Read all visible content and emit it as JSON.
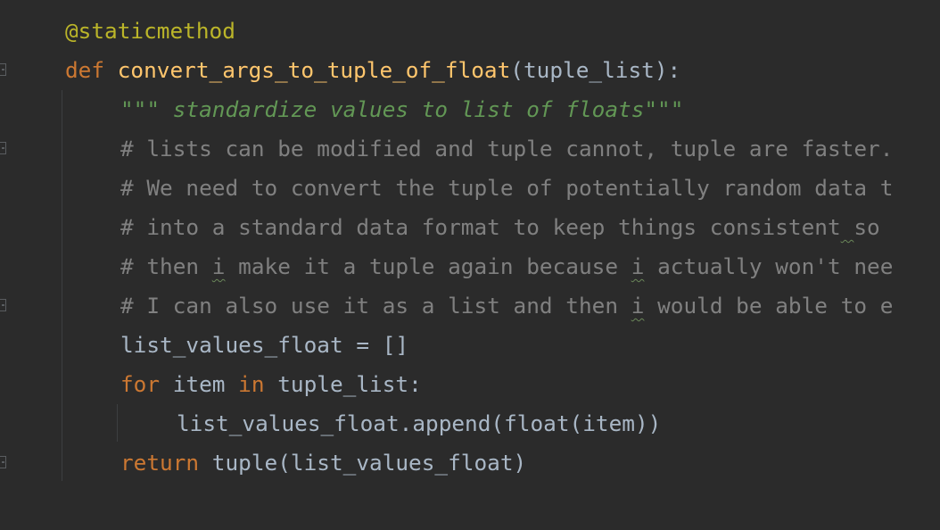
{
  "editor": {
    "lines": [
      {
        "decorator": "@staticmethod"
      },
      {
        "kw": "def",
        "fname": "convert_args_to_tuple_of_float",
        "sig": "(tuple_list):"
      },
      {
        "docstring": "\"\"\" standardize values to list of floats\"\"\""
      },
      {
        "comment": "# lists can be modified and tuple cannot, tuple are faster."
      },
      {
        "comment": "# We need to convert the tuple of potentially random data t"
      },
      {
        "comment_a": "# into a standard data format to keep things consistent",
        "comment_b": " ",
        "comment_typo": "so",
        "comment_c": ""
      },
      {
        "comment_a": "# then ",
        "comment_typo": "i",
        "comment_b": " make it a tuple again because ",
        "comment_typo2": "i",
        "comment_c": " actually won't nee"
      },
      {
        "comment_a": "# I can also use it as a list and then ",
        "comment_typo": "i",
        "comment_b": " would be able to e"
      },
      {
        "code": "list_values_float = []"
      },
      {
        "kw1": "for",
        "mid": " item ",
        "kw2": "in",
        "rest": " tuple_list:"
      },
      {
        "code": "list_values_float.append(float(item))"
      },
      {
        "kw": "return",
        "rest": " tuple(list_values_float)"
      }
    ]
  }
}
